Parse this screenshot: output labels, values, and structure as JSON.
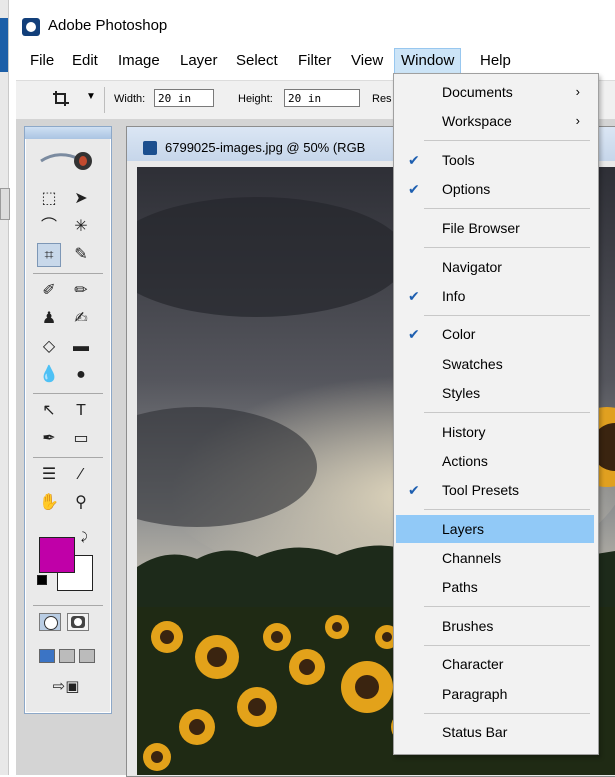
{
  "app": {
    "title": "Adobe Photoshop"
  },
  "menubar": {
    "items": [
      "File",
      "Edit",
      "Image",
      "Layer",
      "Select",
      "Filter",
      "View",
      "Window",
      "Help"
    ],
    "active": "Window"
  },
  "options": {
    "width_label": "Width:",
    "width_value": "20 in",
    "height_label": "Height:",
    "height_value": "20 in",
    "resolution_label_partial": "Res"
  },
  "document": {
    "title": "6799025-images.jpg @ 50% (RGB"
  },
  "window_menu": {
    "groups": [
      [
        {
          "label": "Documents",
          "checked": false,
          "submenu": true
        },
        {
          "label": "Workspace",
          "checked": false,
          "submenu": true
        }
      ],
      [
        {
          "label": "Tools",
          "checked": true
        },
        {
          "label": "Options",
          "checked": true
        }
      ],
      [
        {
          "label": "File Browser",
          "checked": false
        }
      ],
      [
        {
          "label": "Navigator",
          "checked": false
        },
        {
          "label": "Info",
          "checked": true
        }
      ],
      [
        {
          "label": "Color",
          "checked": true
        },
        {
          "label": "Swatches",
          "checked": false
        },
        {
          "label": "Styles",
          "checked": false
        }
      ],
      [
        {
          "label": "History",
          "checked": false
        },
        {
          "label": "Actions",
          "checked": false
        },
        {
          "label": "Tool Presets",
          "checked": true
        }
      ],
      [
        {
          "label": "Layers",
          "checked": false,
          "highlighted": true
        },
        {
          "label": "Channels",
          "checked": false
        },
        {
          "label": "Paths",
          "checked": false
        }
      ],
      [
        {
          "label": "Brushes",
          "checked": false
        }
      ],
      [
        {
          "label": "Character",
          "checked": false
        },
        {
          "label": "Paragraph",
          "checked": false
        }
      ],
      [
        {
          "label": "Status Bar",
          "checked": false
        }
      ]
    ]
  },
  "colors": {
    "foreground": "#c000a8",
    "background": "#ffffff",
    "menu_highlight": "#91c9f7",
    "check": "#1e5fb0"
  }
}
